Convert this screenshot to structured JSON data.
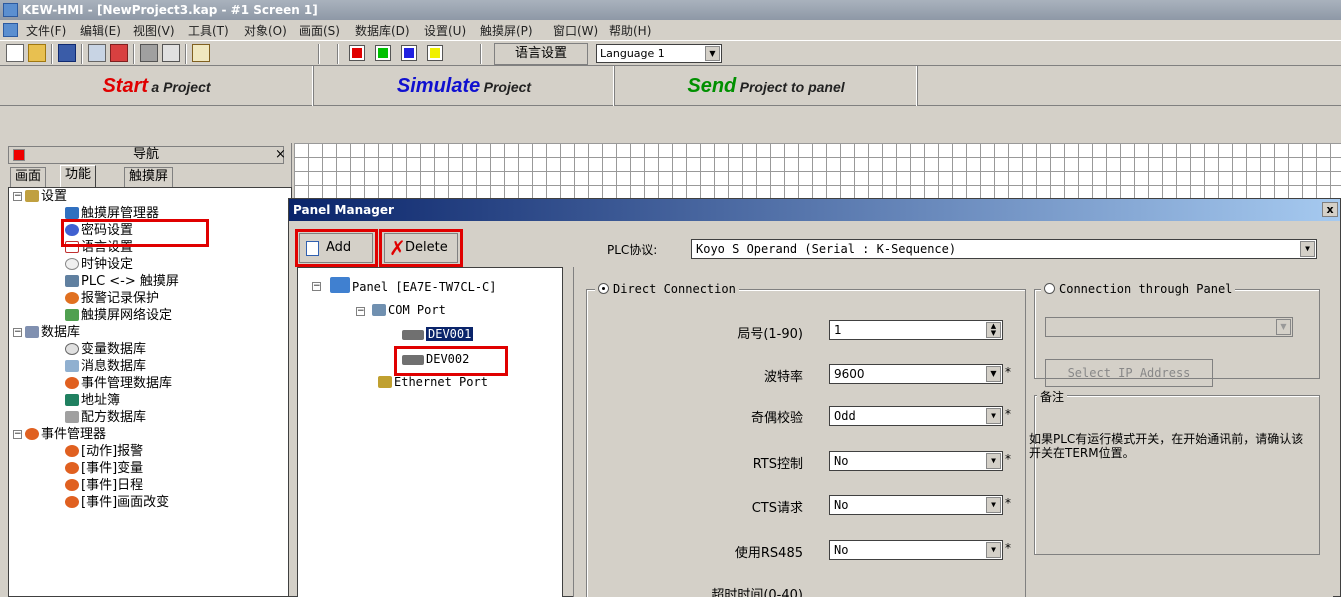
{
  "window": {
    "title": "KEW-HMI - [NewProject3.kap - #1 Screen 1]"
  },
  "menu": [
    "文件(F)",
    "编辑(E)",
    "视图(V)",
    "工具(T)",
    "对象(O)",
    "画面(S)",
    "数据库(D)",
    "设置(U)",
    "触摸屏(P)",
    "窗口(W)",
    "帮助(H)"
  ],
  "toolbar": {
    "language_label": "语言设置",
    "language_value": "Language 1"
  },
  "quickbar": {
    "start_big": "Start",
    "start_small": "a Project",
    "simulate_big": "Simulate",
    "simulate_small": "Project",
    "send_big": "Send",
    "send_small": "Project to panel"
  },
  "nav": {
    "title": "导航",
    "close": "×",
    "tabs": [
      "画面",
      "功能",
      "触摸屏"
    ],
    "tree": [
      "设置",
      "触摸屏管理器",
      "密码设置",
      "语言设置",
      "时钟设定",
      "PLC <-> 触摸屏",
      "报警记录保护",
      "触摸屏网络设定",
      "数据库",
      "变量数据库",
      "消息数据库",
      "事件管理数据库",
      "地址簿",
      "配方数据库",
      "事件管理器",
      "[动作]报警",
      "[事件]变量",
      "[事件]日程",
      "[事件]画面改变"
    ]
  },
  "dialog": {
    "title": "Panel Manager",
    "close": "x",
    "add_label": "Add",
    "delete_label": "Delete",
    "plc_label": "PLC协议:",
    "plc_value": "Koyo S Operand (Serial : K-Sequence)",
    "tree": {
      "panel": "Panel [EA7E-TW7CL-C]",
      "com_port": "COM Port",
      "dev1": "DEV001",
      "dev2": "DEV002",
      "ethernet": "Ethernet Port"
    },
    "direct": {
      "legend": "Direct Connection",
      "station_label": "局号(1-90)",
      "station_value": "1",
      "baud_label": "波特率",
      "baud_value": "9600",
      "parity_label": "奇偶校验",
      "parity_value": "Odd",
      "rts_label": "RTS控制",
      "rts_value": "No",
      "cts_label": "CTS请求",
      "cts_value": "No",
      "rs485_label": "使用RS485",
      "rs485_value": "No",
      "timeout_label": "超时时间(0-40)",
      "star": "*"
    },
    "through": {
      "legend": "Connection through Panel",
      "ip_button": "Select IP Address"
    },
    "note": {
      "legend": "备注",
      "text": "如果PLC有运行模式开关，在开始通讯前，请确认该开关在TERM位置。"
    }
  },
  "colors": {
    "accent_red": "#e00000",
    "start_red": "#e00000",
    "simulate_blue": "#1010d0",
    "send_green": "#009000"
  }
}
